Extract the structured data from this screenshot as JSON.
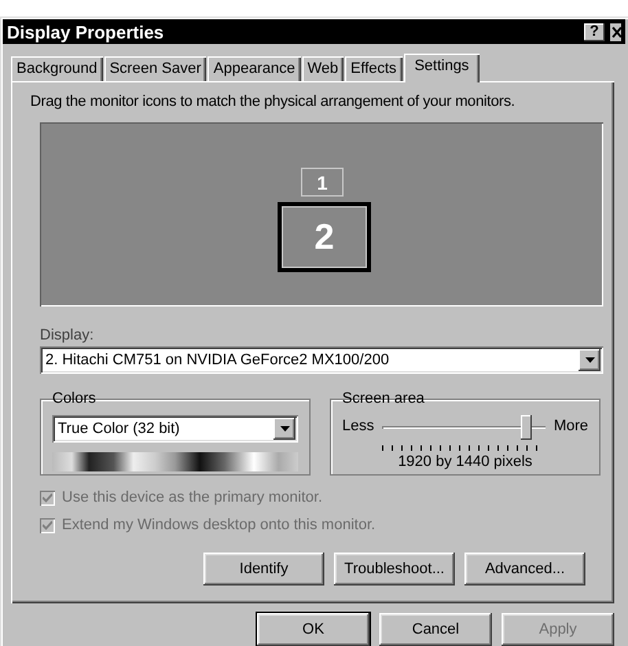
{
  "window": {
    "title": "Display Properties",
    "help": "?"
  },
  "tabs": [
    {
      "label": "Background",
      "selected": false
    },
    {
      "label": "Screen Saver",
      "selected": false
    },
    {
      "label": "Appearance",
      "selected": false
    },
    {
      "label": "Web",
      "selected": false
    },
    {
      "label": "Effects",
      "selected": false
    },
    {
      "label": "Settings",
      "selected": true
    }
  ],
  "instruction": "Drag the monitor icons to match the physical arrangement of your monitors.",
  "monitors": [
    {
      "label": "1",
      "selected": false
    },
    {
      "label": "2",
      "selected": true
    }
  ],
  "display": {
    "label": "Display:",
    "value": "2. Hitachi CM751 on NVIDIA GeForce2 MX100/200"
  },
  "colors": {
    "title": "Colors",
    "value": "True Color (32 bit)"
  },
  "screen_area": {
    "title": "Screen area",
    "less": "Less",
    "more": "More",
    "level": 0.88,
    "reading": "1920 by 1440 pixels"
  },
  "checkboxes": [
    {
      "label": "Use this device as the primary monitor.",
      "checked": true,
      "disabled": true
    },
    {
      "label": "Extend my Windows desktop onto this monitor.",
      "checked": true,
      "disabled": true
    }
  ],
  "buttons": [
    {
      "label": "Identify",
      "disabled": false
    },
    {
      "label": "Troubleshoot...",
      "disabled": false
    },
    {
      "label": "Advanced...",
      "disabled": false
    }
  ],
  "dialog_buttons": [
    {
      "label": "OK",
      "default": true,
      "disabled": false
    },
    {
      "label": "Cancel",
      "default": false,
      "disabled": false
    },
    {
      "label": "Apply",
      "default": false,
      "disabled": true
    }
  ]
}
